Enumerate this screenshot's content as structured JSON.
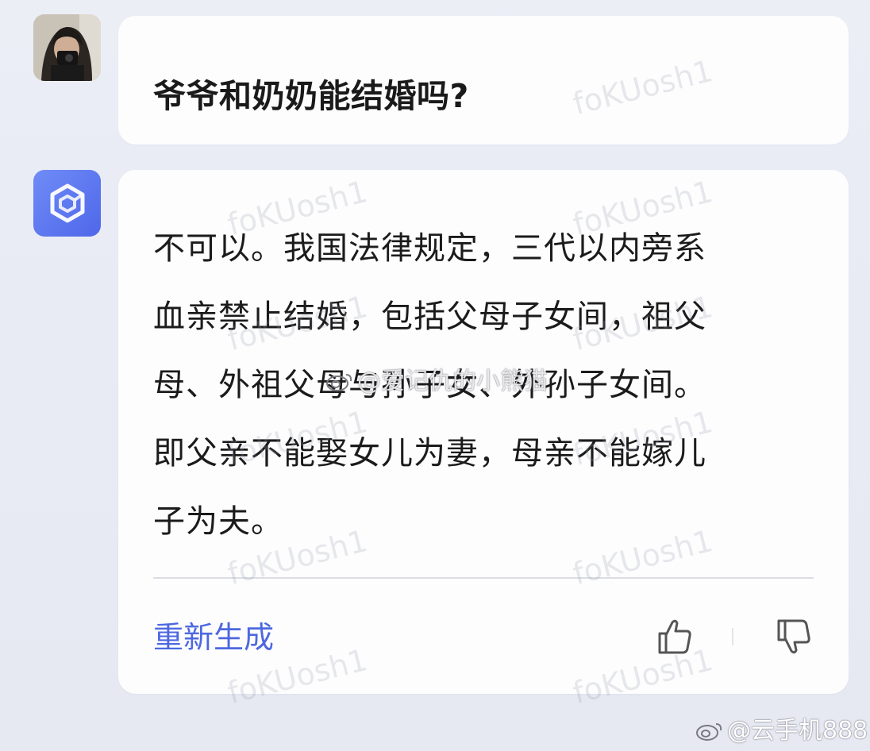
{
  "conversation": {
    "question": "爷爷和奶奶能结婚吗?",
    "answer_lines": [
      "不可以。我国法律规定，三代以内旁系",
      "血亲禁止结婚，包括父母子女间，祖父",
      "母、外祖父母与孙子女、外孙子女间。",
      "即父亲不能娶女儿为妻，母亲不能嫁儿",
      "子为夫。"
    ],
    "regenerate_label": "重新生成"
  },
  "icons": {
    "user_avatar": "user-avatar-photo",
    "bot_avatar": "hexagon-logo-icon",
    "like": "thumbs-up-icon",
    "dislike": "thumbs-down-icon",
    "weibo": "weibo-logo-icon"
  },
  "watermarks": {
    "repeated": "foKUosh1",
    "weibo_mid": "@爱记仇的小熊猫",
    "weibo_bottom": "@云手机888"
  },
  "colors": {
    "background": "#eceef6",
    "bubble": "#fdfdfe",
    "accent": "#4d68e0",
    "bot_avatar": "#5b74ef"
  }
}
